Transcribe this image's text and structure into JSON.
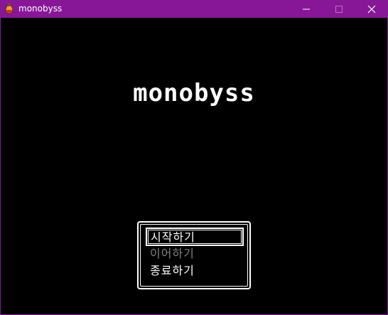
{
  "window": {
    "title": "monobyss",
    "icon": "potion-icon",
    "controls": [
      "minimize-icon",
      "maximize-icon",
      "close-icon"
    ],
    "accent_color": "#881798"
  },
  "game": {
    "title": "monobyss",
    "menu": [
      {
        "label": "시작하기",
        "state": "selected"
      },
      {
        "label": "이어하기",
        "state": "disabled"
      },
      {
        "label": "종료하기",
        "state": "normal"
      }
    ]
  }
}
